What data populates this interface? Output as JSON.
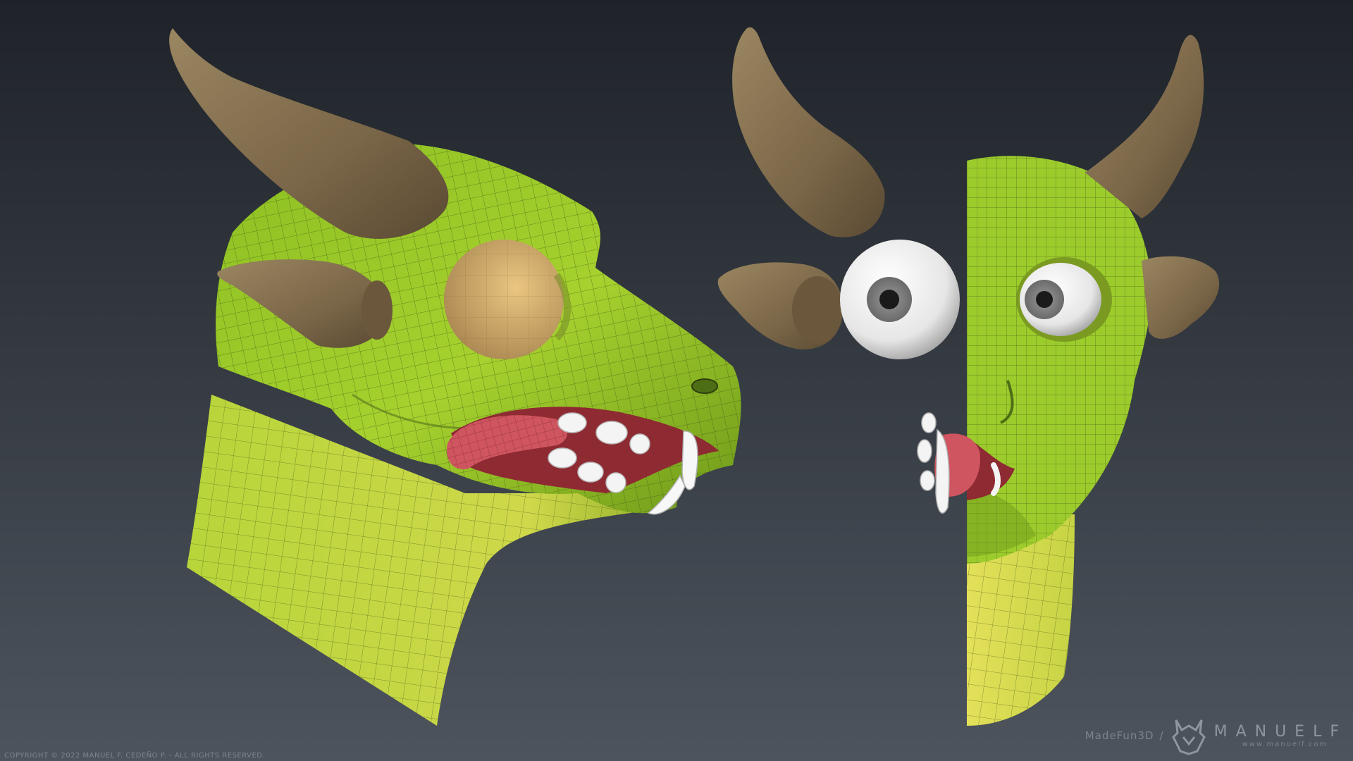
{
  "footer": {
    "copyright": "COPYRIGHT © 2022 MANUEL F. CEDEÑO P. - ALL RIGHTS RESERVED."
  },
  "brand": {
    "studio": "MadeFun3D",
    "separator": "/",
    "name": "MANUELF",
    "url": "www.manuelf.com",
    "logo_icon": "manuelf-horned-mask-logo"
  },
  "colors": {
    "background_top": "#1f2329",
    "background_bottom": "#4b525b",
    "skin": "#9ccc2c",
    "skin_light": "#d7e34a",
    "horn": "#7a6648",
    "eye_socket": "#c8a466",
    "tongue": "#c8505a",
    "teeth": "#f2f2f2",
    "wire": "#3a4a14"
  }
}
